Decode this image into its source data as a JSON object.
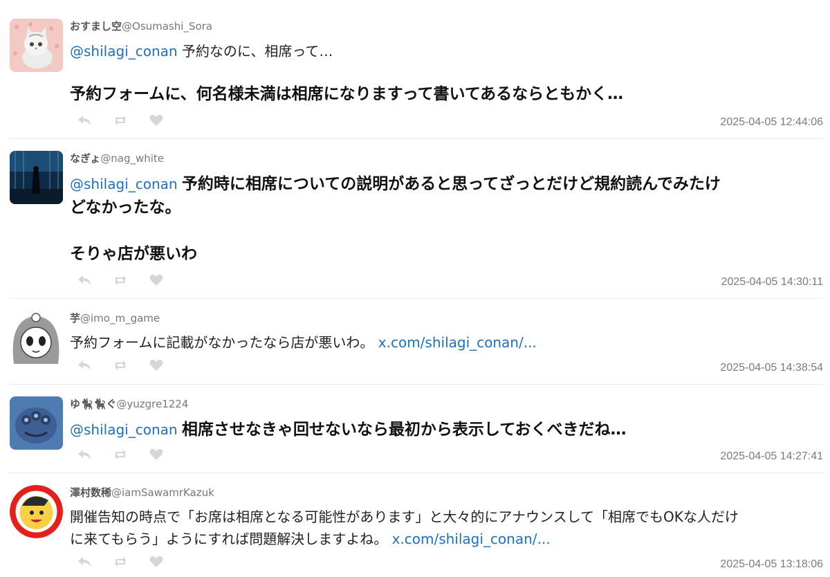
{
  "tweets": [
    {
      "display_name": "おすまし空",
      "handle": "@Osumashi_Sora",
      "mention": "@shilagi_conan",
      "text_line1": "予約なのに、相席って…",
      "text_bold": "予約フォームに、何名様未満は相席になりますって書いてあるならともかく…",
      "timestamp": "2025-04-05 12:44:06"
    },
    {
      "display_name": "なぎょ",
      "handle": "@nag_white",
      "mention": "@shilagi_conan",
      "text_bold1": "予約時に相席についての説明があると思ってざっとだけど規約読んでみたけ",
      "text_bold2": "どなかったな。",
      "text_bold3": "そりゃ店が悪いわ",
      "timestamp": "2025-04-05 14:30:11"
    },
    {
      "display_name": "芋",
      "handle": "@imo_m_game",
      "text": "予約フォームに記載がなかったなら店が悪いわ。",
      "link": "x.com/shilagi_conan/...",
      "timestamp": "2025-04-05 14:38:54"
    },
    {
      "display_name": "ゆ🐈‍⬛🐈‍⬛ぐ",
      "handle": "@yuzgre1224",
      "mention": "@shilagi_conan",
      "text_bold": "相席させなきゃ回せないなら最初から表示しておくべきだね…",
      "timestamp": "2025-04-05 14:27:41"
    },
    {
      "display_name": "澤村数稀",
      "handle": "@iamSawamrKazuk",
      "text_line1": "開催告知の時点で「お席は相席となる可能性があります」と大々的にアナウンスして「相席でもOKな人だけ",
      "text_line2": "に来てもらう」ようにすれば問題解決しますよね。",
      "link": "x.com/shilagi_conan/...",
      "timestamp": "2025-04-05 13:18:06"
    }
  ],
  "icons": {
    "reply": "reply-icon",
    "retweet": "retweet-icon",
    "like": "heart-icon"
  },
  "colors": {
    "link": "#1e6fc0",
    "icon": "#d6d6d6",
    "timestamp": "#7a7a7a"
  }
}
